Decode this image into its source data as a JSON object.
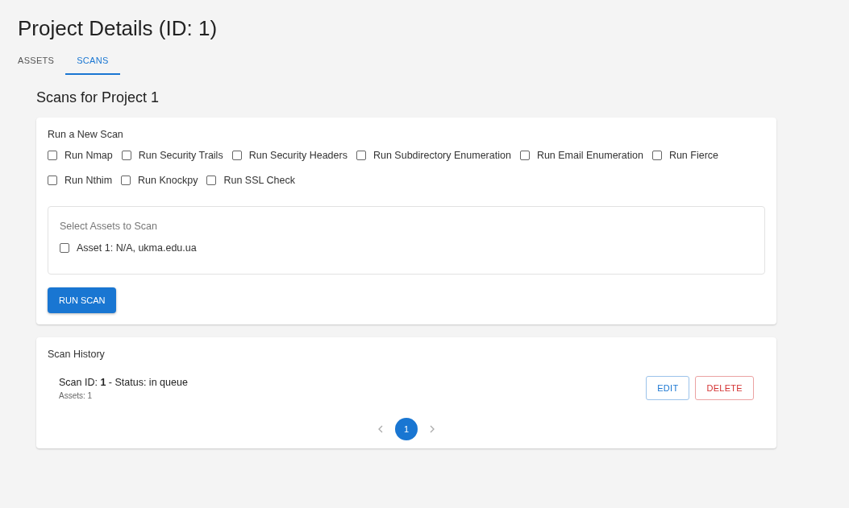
{
  "title": "Project Details (ID: 1)",
  "tabs": [
    {
      "label": "ASSETS",
      "selected": false
    },
    {
      "label": "SCANS",
      "selected": true
    }
  ],
  "heading": "Scans for Project 1",
  "new_scan": {
    "title": "Run a New Scan",
    "options": [
      {
        "label": "Run Nmap",
        "checked": false
      },
      {
        "label": "Run Security Trails",
        "checked": false
      },
      {
        "label": "Run Security Headers",
        "checked": false
      },
      {
        "label": "Run Subdirectory Enumeration",
        "checked": false
      },
      {
        "label": "Run Email Enumeration",
        "checked": false
      },
      {
        "label": "Run Fierce",
        "checked": false
      },
      {
        "label": "Run Nthim",
        "checked": false
      },
      {
        "label": "Run Knockpy",
        "checked": false
      },
      {
        "label": "Run SSL Check",
        "checked": false
      }
    ],
    "assets": {
      "title": "Select Assets to Scan",
      "items": [
        {
          "label": "Asset 1: N/A, ukma.edu.ua",
          "checked": false
        }
      ]
    },
    "button": "RUN SCAN"
  },
  "history": {
    "title": "Scan History",
    "scans": [
      {
        "text": "Scan ID: **1** - Status: in queue",
        "assets": "Assets: 1",
        "actions": [
          "EDIT",
          "DELETE"
        ]
      }
    ],
    "pages": [
      {
        "label": "1",
        "selected": true
      }
    ]
  }
}
